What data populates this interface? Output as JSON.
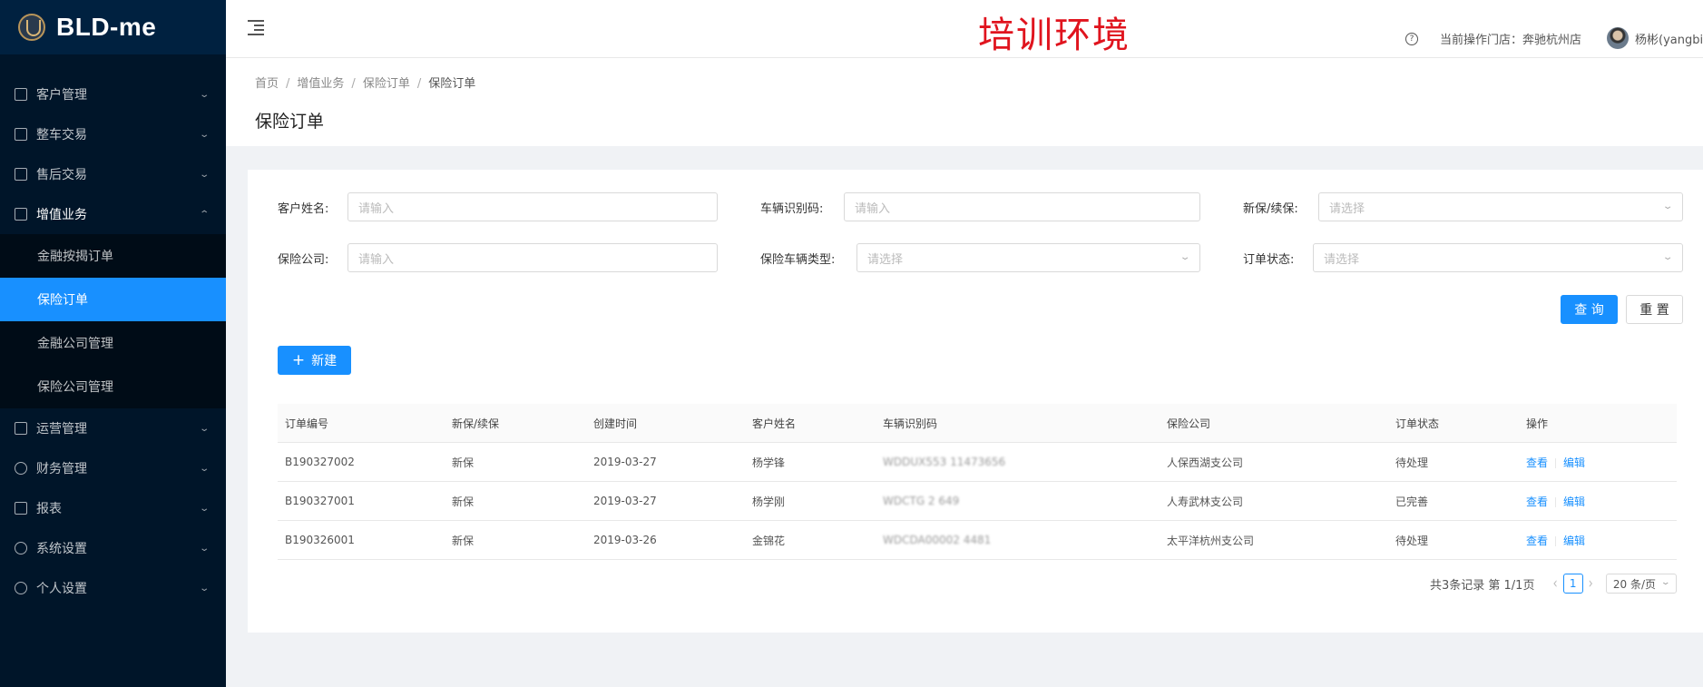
{
  "app": {
    "title": "BLD-me",
    "env_title": "培训环境"
  },
  "sidebar": {
    "items_top": [
      {
        "label": "客户管理",
        "icon": "id-card-icon"
      },
      {
        "label": "整车交易",
        "icon": "car-icon"
      },
      {
        "label": "售后交易",
        "icon": "table-icon"
      },
      {
        "label": "增值业务",
        "icon": "profile-icon",
        "open": true
      }
    ],
    "submenu": [
      {
        "label": "金融按揭订单"
      },
      {
        "label": "保险订单",
        "active": true
      },
      {
        "label": "金融公司管理"
      },
      {
        "label": "保险公司管理"
      }
    ],
    "items_bottom": [
      {
        "label": "运营管理",
        "icon": "gift-icon"
      },
      {
        "label": "财务管理",
        "icon": "money-icon"
      },
      {
        "label": "报表",
        "icon": "line-chart-icon"
      },
      {
        "label": "系统设置",
        "icon": "gear-icon"
      },
      {
        "label": "个人设置",
        "icon": "user-icon"
      }
    ]
  },
  "header": {
    "store_label": "当前操作门店：奔驰杭州店",
    "username": "杨彬(yangbi"
  },
  "breadcrumb": {
    "home": "首页",
    "l2": "增值业务",
    "l3": "保险订单",
    "current": "保险订单"
  },
  "page_title": "保险订单",
  "filters": {
    "customer_name": {
      "label": "客户姓名:",
      "placeholder": "请输入"
    },
    "vin": {
      "label": "车辆识别码:",
      "placeholder": "请输入"
    },
    "new_renew": {
      "label": "新保/续保:",
      "placeholder": "请选择"
    },
    "insurer": {
      "label": "保险公司:",
      "placeholder": "请输入"
    },
    "vehicle_type": {
      "label": "保险车辆类型:",
      "placeholder": "请选择"
    },
    "order_status": {
      "label": "订单状态:",
      "placeholder": "请选择"
    }
  },
  "buttons": {
    "query": "查 询",
    "reset": "重 置",
    "new": "新建"
  },
  "table": {
    "headers": [
      "订单编号",
      "新保/续保",
      "创建时间",
      "客户姓名",
      "车辆识别码",
      "保险公司",
      "订单状态",
      "操作"
    ],
    "rows": [
      {
        "order_no": "B190327002",
        "type": "新保",
        "created": "2019-03-27",
        "customer": "杨学锋",
        "vin": "WDDUX553 11473656",
        "insurer": "人保西湖支公司",
        "status": "待处理",
        "view": "查看",
        "edit": "编辑"
      },
      {
        "order_no": "B190327001",
        "type": "新保",
        "created": "2019-03-27",
        "customer": "杨学刚",
        "vin": "WDCTG 2 649",
        "insurer": "人寿武林支公司",
        "status": "已完善",
        "view": "查看",
        "edit": "编辑"
      },
      {
        "order_no": "B190326001",
        "type": "新保",
        "created": "2019-03-26",
        "customer": "金锦花",
        "vin": "WDCDA00002 4481",
        "insurer": "太平洋杭州支公司",
        "status": "待处理",
        "view": "查看",
        "edit": "编辑"
      }
    ]
  },
  "pagination": {
    "total": "共3条记录 第 1/1页",
    "current": "1",
    "page_size": "20 条/页"
  }
}
